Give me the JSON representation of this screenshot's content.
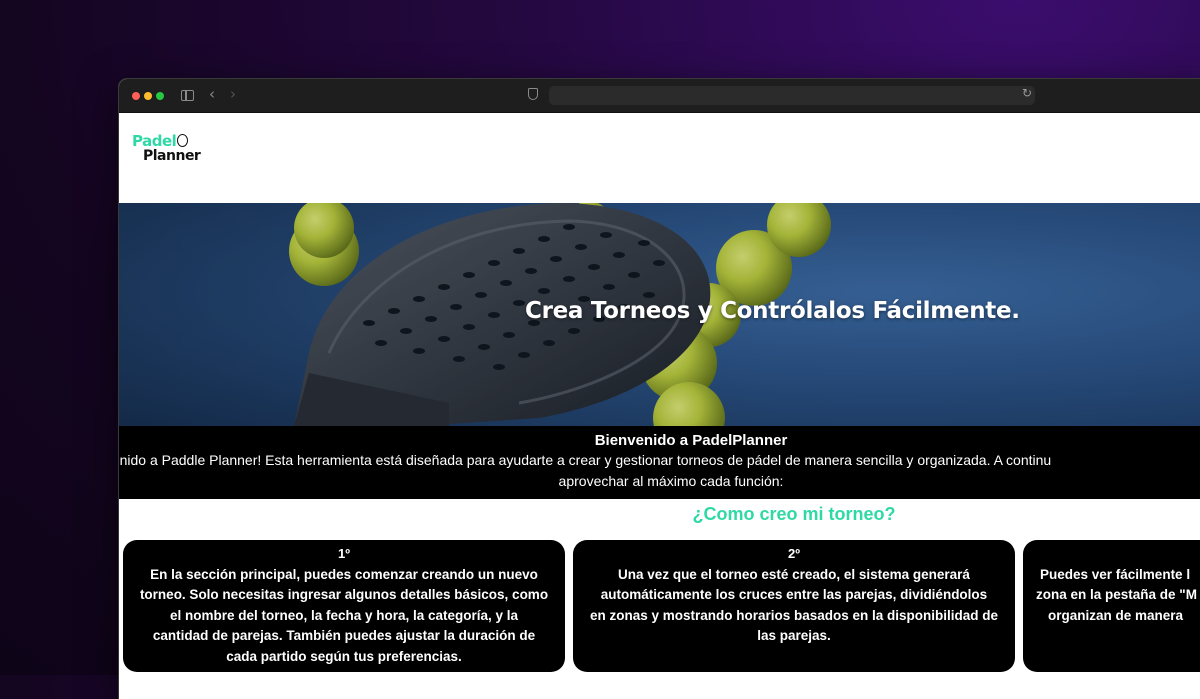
{
  "browser": {
    "address": ""
  },
  "nav": {
    "logo_line1": "Padel",
    "logo_line2": "Planner"
  },
  "hero": {
    "title": "Crea Torneos y Contrólalos Fácilmente."
  },
  "welcome": {
    "title": "Bienvenido a PadelPlanner",
    "line1": "Bienvenido a Paddle Planner! Esta herramienta está diseñada para ayudarte a crear y gestionar torneos de pádel de manera sencilla y organizada. A continu",
    "line2": "aprovechar al máximo cada función:"
  },
  "how": {
    "title": "¿Como creo mi torneo?"
  },
  "cards": [
    {
      "number": "1º",
      "lines": [
        "En la sección principal, puedes comenzar creando un nuevo",
        "torneo. Solo necesitas ingresar algunos detalles básicos, como",
        "el nombre del torneo, la fecha y hora, la categoría, y la",
        "cantidad de parejas. También puedes ajustar la duración de",
        "cada partido según tus preferencias."
      ]
    },
    {
      "number": "2º",
      "lines": [
        "Una vez que el torneo esté creado, el sistema generará",
        "automáticamente los cruces entre las parejas, dividiéndolos",
        "en zonas y mostrando horarios basados en la disponibilidad de",
        "las parejas."
      ]
    },
    {
      "number": "",
      "lines": [
        "Puedes ver fácilmente l",
        "zona en la pestaña de \"M",
        "organizan de manera"
      ]
    }
  ]
}
